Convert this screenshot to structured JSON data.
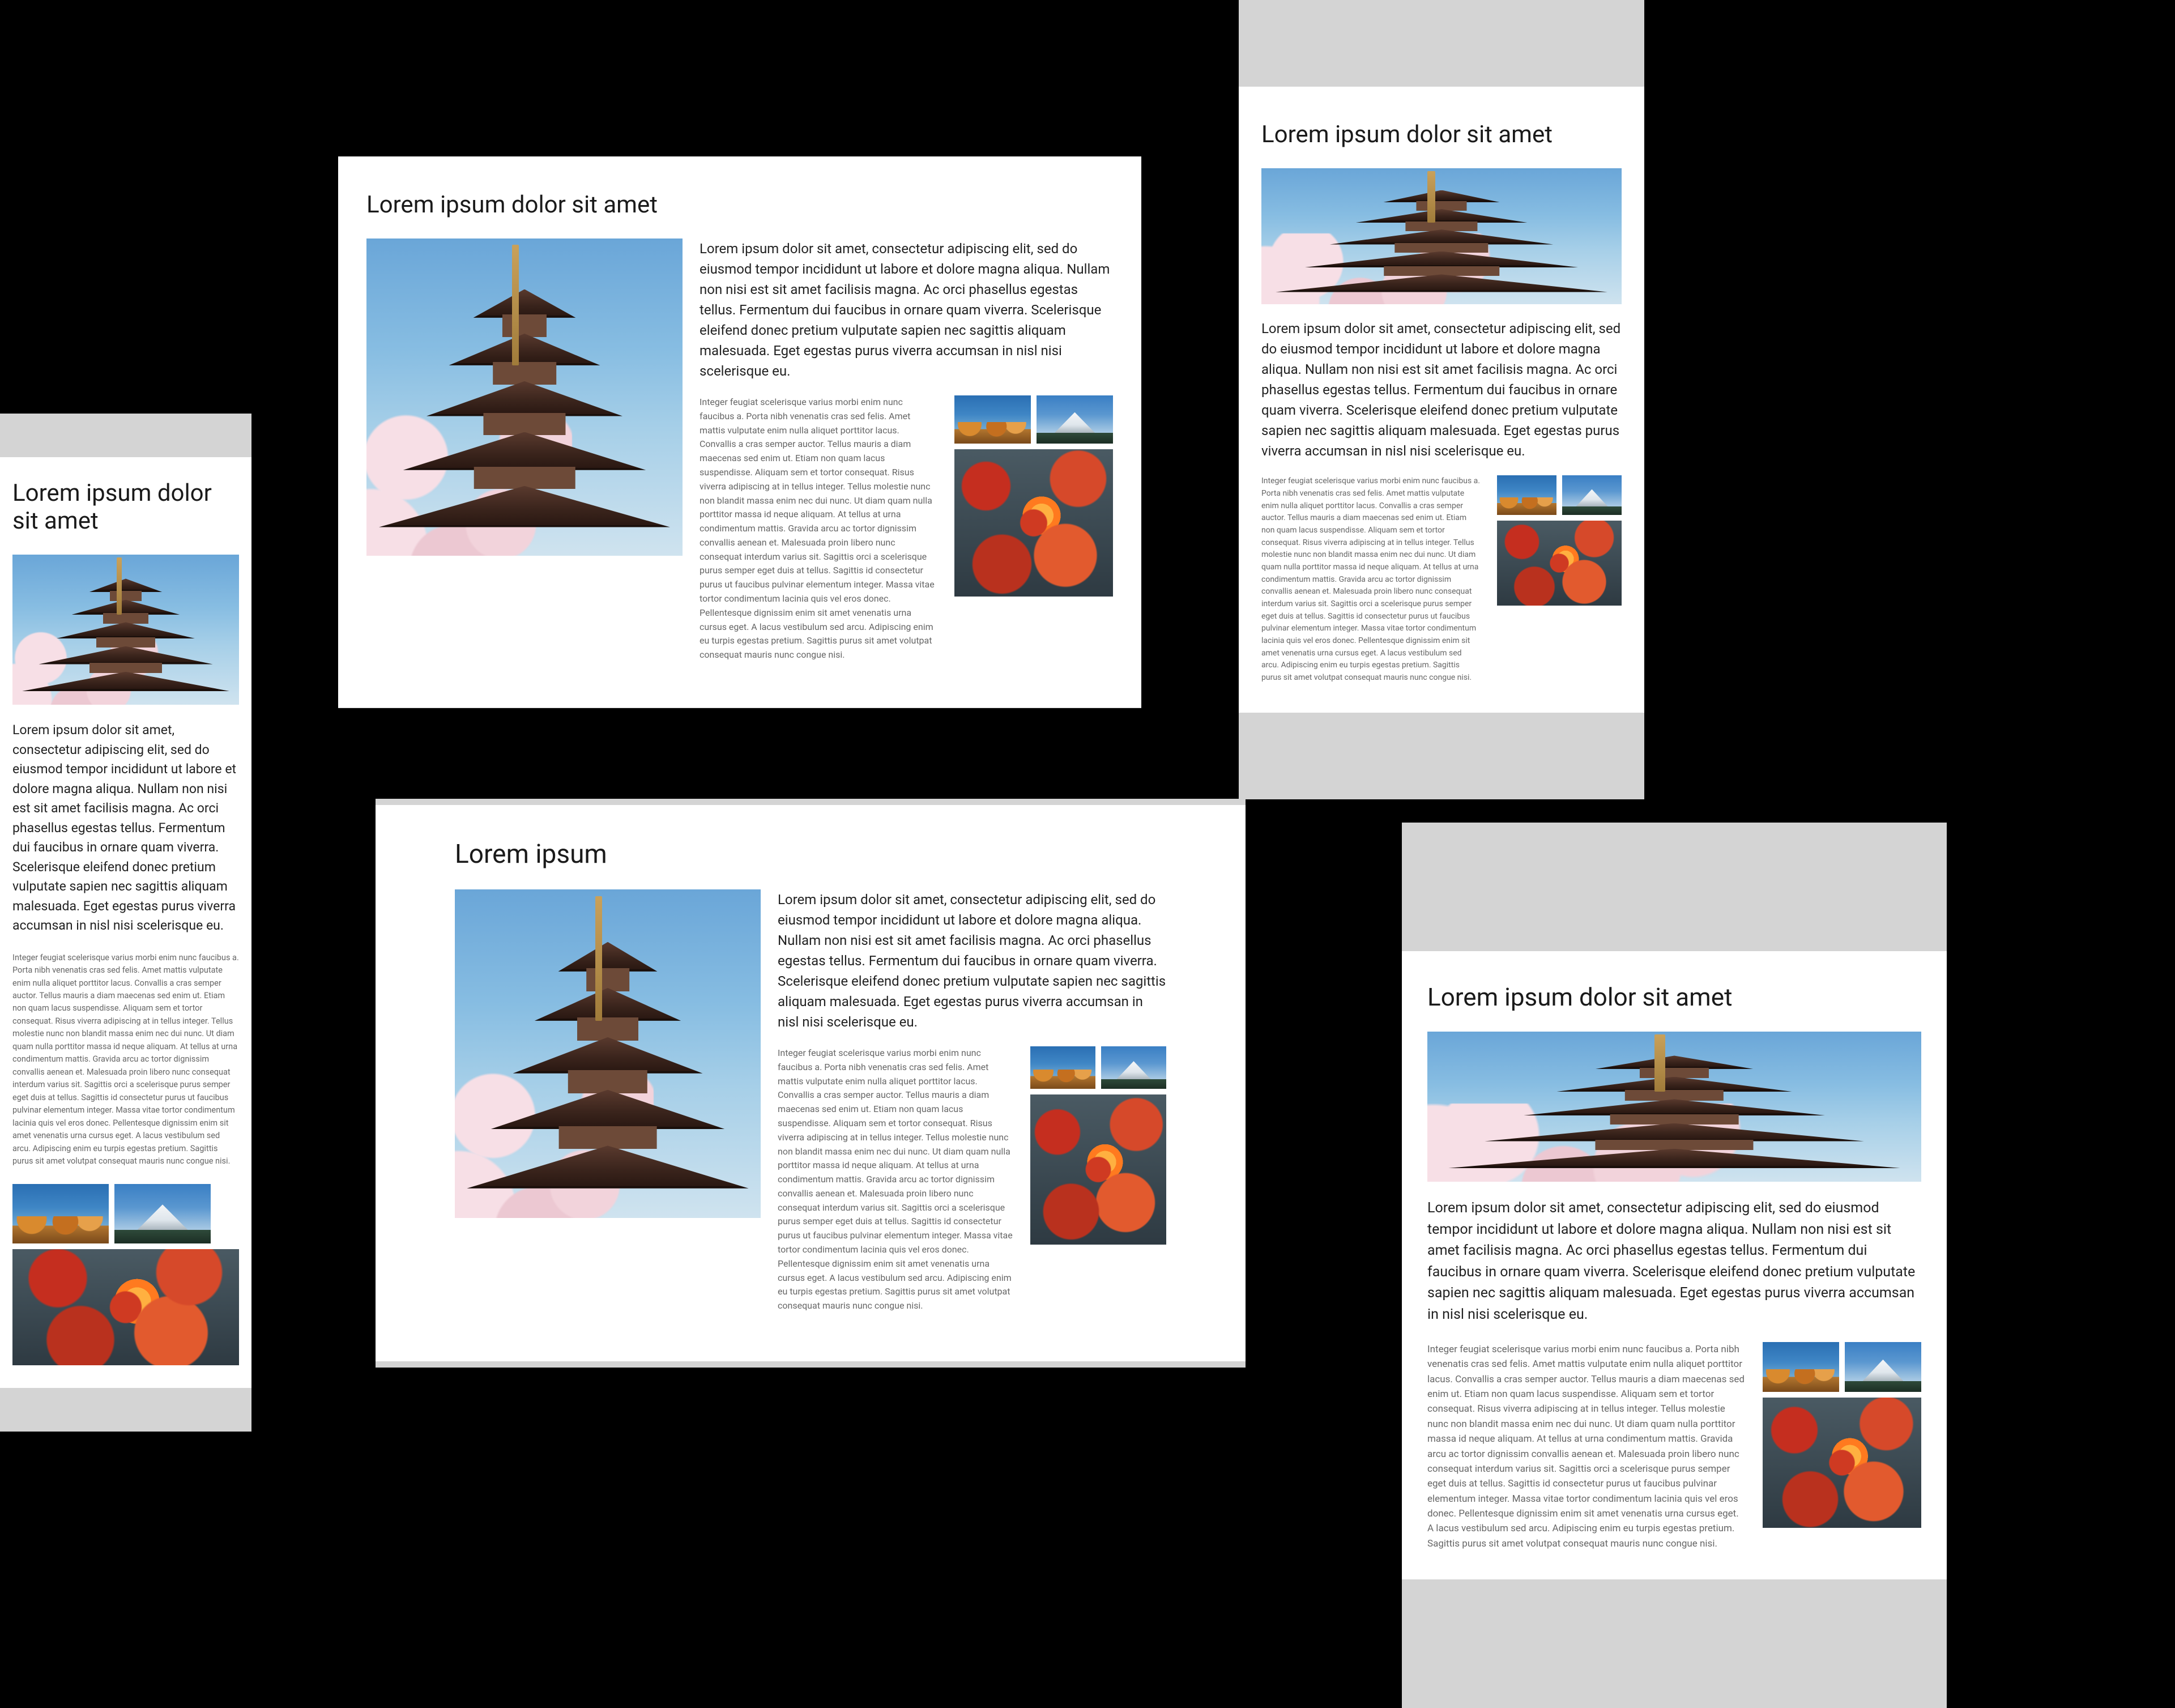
{
  "panels": [
    {
      "title": "Lorem ipsum dolor sit amet",
      "lead": "Lorem ipsum dolor sit amet, consectetur adipiscing elit, sed do eiusmod tempor incididunt ut labore et dolore magna aliqua. Nullam non nisi est sit amet facilisis magna. Ac orci phasellus egestas tellus. Fermentum dui faucibus in ornare quam viverra. Scelerisque eleifend donec pretium vulputate sapien nec sagittis aliquam malesuada. Eget egestas purus viverra accumsan in nisl nisi scelerisque eu.",
      "fine": "Integer feugiat scelerisque varius morbi enim nunc faucibus a. Porta nibh venenatis cras sed felis. Amet mattis vulputate enim nulla aliquet porttitor lacus. Convallis a cras semper auctor. Tellus mauris a diam maecenas sed enim ut. Etiam non quam lacus suspendisse. Aliquam sem et tortor consequat. Risus viverra adipiscing at in tellus integer. Tellus molestie nunc non blandit massa enim nec dui nunc. Ut diam quam nulla porttitor massa id neque aliquam. At tellus at urna condimentum mattis. Gravida arcu ac tortor dignissim convallis aenean et. Malesuada proin libero nunc consequat interdum varius sit. Sagittis orci a scelerisque purus semper eget duis at tellus. Sagittis id consectetur purus ut faucibus pulvinar elementum integer. Massa vitae tortor condimentum lacinia quis vel eros donec. Pellentesque dignissim enim sit amet venenatis urna cursus eget. A lacus vestibulum sed arcu. Adipiscing enim eu turpis egestas pretium. Sagittis purus sit amet volutpat consequat mauris nunc congue nisi."
    },
    {
      "title": "Lorem ipsum dolor sit amet",
      "lead": "Lorem ipsum dolor sit amet, consectetur adipiscing elit, sed do eiusmod tempor incididunt ut labore et dolore magna aliqua. Nullam non nisi est sit amet facilisis magna. Ac orci phasellus egestas tellus. Fermentum dui faucibus in ornare quam viverra. Scelerisque eleifend donec pretium vulputate sapien nec sagittis aliquam malesuada. Eget egestas purus viverra accumsan in nisl nisi scelerisque eu.",
      "fine": "Integer feugiat scelerisque varius morbi enim nunc faucibus a. Porta nibh venenatis cras sed felis. Amet mattis vulputate enim nulla aliquet porttitor lacus. Convallis a cras semper auctor. Tellus mauris a diam maecenas sed enim ut. Etiam non quam lacus suspendisse. Aliquam sem et tortor consequat. Risus viverra adipiscing at in tellus integer. Tellus molestie nunc non blandit massa enim nec dui nunc. Ut diam quam nulla porttitor massa id neque aliquam. At tellus at urna condimentum mattis. Gravida arcu ac tortor dignissim convallis aenean et. Malesuada proin libero nunc consequat interdum varius sit. Sagittis orci a scelerisque purus semper eget duis at tellus. Sagittis id consectetur purus ut faucibus pulvinar elementum integer. Massa vitae tortor condimentum lacinia quis vel eros donec. Pellentesque dignissim enim sit amet venenatis urna cursus eget. A lacus vestibulum sed arcu. Adipiscing enim eu turpis egestas pretium. Sagittis purus sit amet volutpat consequat mauris nunc congue nisi."
    },
    {
      "title": "Lorem ipsum dolor sit amet",
      "lead": "Lorem ipsum dolor sit amet, consectetur adipiscing elit, sed do eiusmod tempor incididunt ut labore et dolore magna aliqua. Nullam non nisi est sit amet facilisis magna. Ac orci phasellus egestas tellus. Fermentum dui faucibus in ornare quam viverra. Scelerisque eleifend donec pretium vulputate sapien nec sagittis aliquam malesuada. Eget egestas purus viverra accumsan in nisl nisi scelerisque eu.",
      "fine": "Integer feugiat scelerisque varius morbi enim nunc faucibus a. Porta nibh venenatis cras sed felis. Amet mattis vulputate enim nulla aliquet porttitor lacus. Convallis a cras semper auctor. Tellus mauris a diam maecenas sed enim ut. Etiam non quam lacus suspendisse. Aliquam sem et tortor consequat. Risus viverra adipiscing at in tellus integer. Tellus molestie nunc non blandit massa enim nec dui nunc. Ut diam quam nulla porttitor massa id neque aliquam. At tellus at urna condimentum mattis. Gravida arcu ac tortor dignissim convallis aenean et. Malesuada proin libero nunc consequat interdum varius sit. Sagittis orci a scelerisque purus semper eget duis at tellus. Sagittis id consectetur purus ut faucibus pulvinar elementum integer. Massa vitae tortor condimentum lacinia quis vel eros donec. Pellentesque dignissim enim sit amet venenatis urna cursus eget. A lacus vestibulum sed arcu. Adipiscing enim eu turpis egestas pretium. Sagittis purus sit amet volutpat consequat mauris nunc congue nisi."
    },
    {
      "title": "Lorem ipsum",
      "lead": "Lorem ipsum dolor sit amet, consectetur adipiscing elit, sed do eiusmod tempor incididunt ut labore et dolore magna aliqua. Nullam non nisi est sit amet facilisis magna. Ac orci phasellus egestas tellus. Fermentum dui faucibus in ornare quam viverra. Scelerisque eleifend donec pretium vulputate sapien nec sagittis aliquam malesuada. Eget egestas purus viverra accumsan in nisl nisi scelerisque eu.",
      "fine": "Integer feugiat scelerisque varius morbi enim nunc faucibus a. Porta nibh venenatis cras sed felis. Amet mattis vulputate enim nulla aliquet porttitor lacus. Convallis a cras semper auctor. Tellus mauris a diam maecenas sed enim ut. Etiam non quam lacus suspendisse. Aliquam sem et tortor consequat. Risus viverra adipiscing at in tellus integer. Tellus molestie nunc non blandit massa enim nec dui nunc. Ut diam quam nulla porttitor massa id neque aliquam. At tellus at urna condimentum mattis. Gravida arcu ac tortor dignissim convallis aenean et. Malesuada proin libero nunc consequat interdum varius sit. Sagittis orci a scelerisque purus semper eget duis at tellus. Sagittis id consectetur purus ut faucibus pulvinar elementum integer. Massa vitae tortor condimentum lacinia quis vel eros donec. Pellentesque dignissim enim sit amet venenatis urna cursus eget. A lacus vestibulum sed arcu. Adipiscing enim eu turpis egestas pretium. Sagittis purus sit amet volutpat consequat mauris nunc congue nisi."
    },
    {
      "title": "Lorem ipsum dolor sit amet",
      "lead": "Lorem ipsum dolor sit amet, consectetur adipiscing elit, sed do eiusmod tempor incididunt ut labore et dolore magna aliqua. Nullam non nisi est sit amet facilisis magna. Ac orci phasellus egestas tellus. Fermentum dui faucibus in ornare quam viverra. Scelerisque eleifend donec pretium vulputate sapien nec sagittis aliquam malesuada. Eget egestas purus viverra accumsan in nisl nisi scelerisque eu.",
      "fine": "Integer feugiat scelerisque varius morbi enim nunc faucibus a. Porta nibh venenatis cras sed felis. Amet mattis vulputate enim nulla aliquet porttitor lacus. Convallis a cras semper auctor. Tellus mauris a diam maecenas sed enim ut. Etiam non quam lacus suspendisse. Aliquam sem et tortor consequat. Risus viverra adipiscing at in tellus integer. Tellus molestie nunc non blandit massa enim nec dui nunc. Ut diam quam nulla porttitor massa id neque aliquam. At tellus at urna condimentum mattis. Gravida arcu ac tortor dignissim convallis aenean et. Malesuada proin libero nunc consequat interdum varius sit. Sagittis orci a scelerisque purus semper eget duis at tellus. Sagittis id consectetur purus ut faucibus pulvinar elementum integer. Massa vitae tortor condimentum lacinia quis vel eros donec. Pellentesque dignissim enim sit amet venenatis urna cursus eget. A lacus vestibulum sed arcu. Adipiscing enim eu turpis egestas pretium. Sagittis purus sit amet volutpat consequat mauris nunc congue nisi."
    }
  ]
}
